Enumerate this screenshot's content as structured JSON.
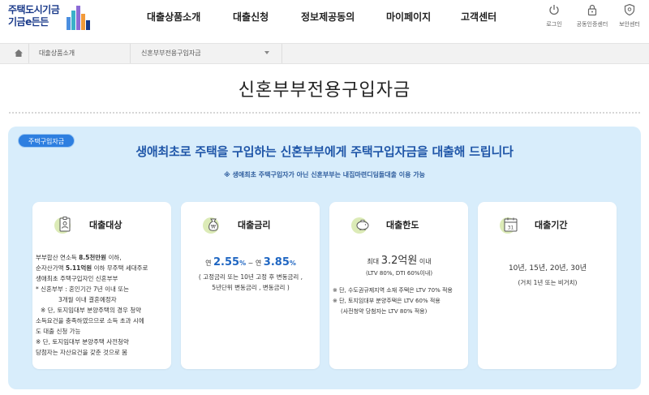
{
  "brand": {
    "logo_line1": "주택도시기금",
    "logo_line2": "기금e든든",
    "bar_colors": [
      "#4b8fe0",
      "#3bb0c9",
      "#8c6bd6",
      "#f29a3a",
      "#1a3a8a"
    ]
  },
  "nav": {
    "items": [
      "대출상품소개",
      "대출신청",
      "정보제공동의",
      "마이페이지",
      "고객센터"
    ]
  },
  "util": {
    "login": "로그인",
    "cert": "공동인증센터",
    "security": "보안센터"
  },
  "breadcrumb": {
    "level1": "대출상품소개",
    "level2": "신혼부부전용구입자금"
  },
  "page": {
    "title": "신혼부부전용구입자금"
  },
  "panel": {
    "badge": "주택구입자금",
    "headline": "생애최초로 주택을 구입하는 신혼부부에게  주택구입자금을 대출해 드립니다",
    "note": "※ 생애최초 주택구입자가 아닌 신혼부부는 내집마련디딤돌대출 이용 가능"
  },
  "cards": {
    "target": {
      "title": "대출대상",
      "l1a": "부부합산 연소득 ",
      "l1b": "8.5천만원",
      "l1c": " 이하,",
      "l2a": "순자산가액 ",
      "l2b": "5.11억원",
      "l2c": " 이하 무주택 세대주로",
      "l3": "생애최초 주택구입자인 신혼부부",
      "l4": "* 신혼부부 : 혼인기간 7년 이내 또는",
      "l5": "3개월 이내 결혼예정자",
      "l6": "※ 단, 토지임대부 분양주택의 경우 청약",
      "l7": "소득요건을 충족하였으므로 소득 초과 시에",
      "l8": "도 대출 신청 가능",
      "l9": "※ 단, 토지임대부 분양주택 사전청약",
      "l10": "당첨자는 자산요건을 갖춘 것으로 봄"
    },
    "rate": {
      "title": "대출금리",
      "prefix": "연 ",
      "low": "2.55",
      "pct1": "%",
      "dash": " ~ 연 ",
      "high": "3.85",
      "pct2": "%",
      "l2": "( 고정금리 또는 10년 고정 후 변동금리 ,",
      "l3": "5년단위 변동금리 , 변동금리 )"
    },
    "limit": {
      "title": "대출한도",
      "prefix": "최대 ",
      "amount": "3.2억원",
      "suffix": " 이내",
      "l2": "(LTV 80%, DTI 60%이내)",
      "l3": "※ 단, 수도권규제지역 소재 주택은 LTV 70% 적용",
      "l4": "※ 단, 토지임대부 분양주택은 LTV 60% 적용",
      "l5": "(사전청약 당첨자는 LTV 80% 적용)"
    },
    "term": {
      "title": "대출기간",
      "calendar_day": "31",
      "l1": "10년, 15년, 20년, 30년",
      "l2": "(거치 1년 또는 비거치)"
    }
  }
}
